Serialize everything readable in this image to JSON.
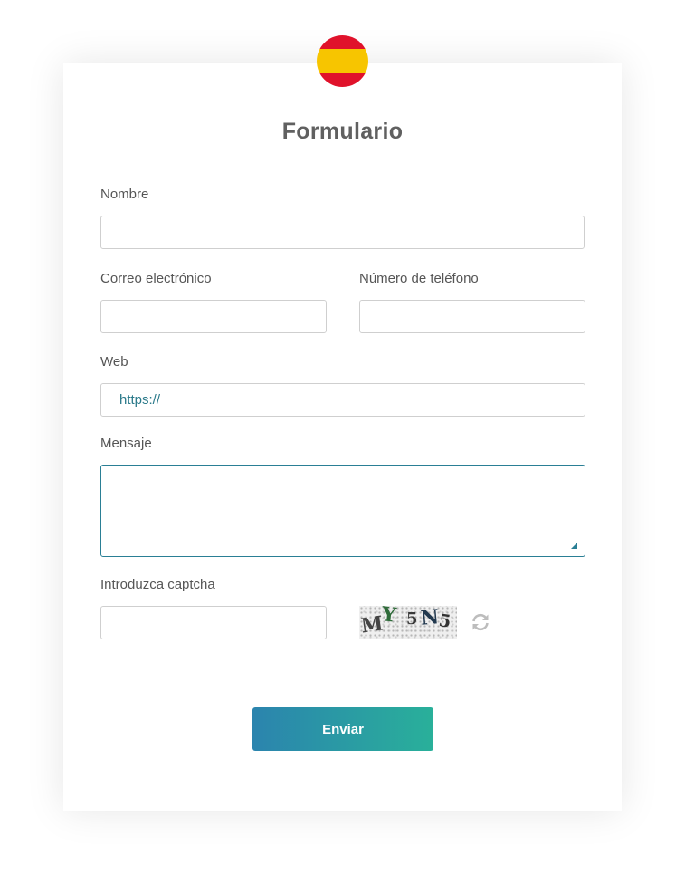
{
  "form": {
    "title": "Formulario",
    "fields": {
      "name": {
        "label": "Nombre",
        "value": ""
      },
      "email": {
        "label": "Correo electrónico",
        "value": ""
      },
      "phone": {
        "label": "Número de teléfono",
        "value": ""
      },
      "web": {
        "label": "Web",
        "value": "https://"
      },
      "message": {
        "label": "Mensaje",
        "value": ""
      },
      "captcha": {
        "label": "Introduzca captcha",
        "value": ""
      }
    },
    "captcha_image": {
      "characters": [
        "M",
        "Y",
        "5",
        "N",
        "5"
      ],
      "colors": [
        "#444444",
        "#2f6b3a",
        "#3a3a3a",
        "#22394f",
        "#333333"
      ]
    },
    "submit_label": "Enviar",
    "flag": "spain-flag-icon",
    "refresh_icon": "refresh-icon"
  },
  "colors": {
    "accent": "#2a7f95",
    "button_gradient_start": "#2b84ae",
    "button_gradient_end": "#29b09a"
  }
}
